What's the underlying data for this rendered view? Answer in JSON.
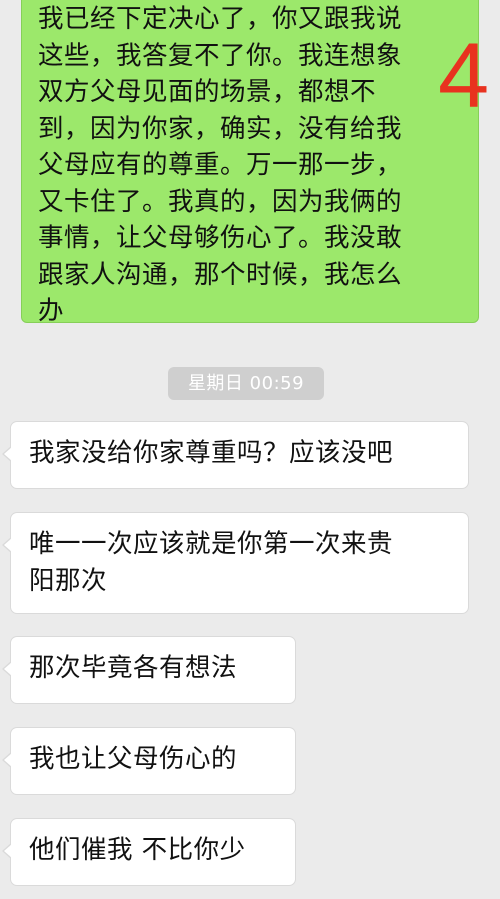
{
  "overlay": {
    "number": "4"
  },
  "messages": {
    "outgoing_1": {
      "text": "我已经下定决心了，你又跟我说\n这些，我答复不了你。我连想象\n双方父母见面的场景，都想不\n到，因为你家，确实，没有给我\n父母应有的尊重。万一那一步，\n又卡住了。我真的，因为我俩的\n事情，让父母够伤心了。我没敢\n跟家人沟通，那个时候，我怎么\n办"
    },
    "timestamp": "星期日 00:59",
    "incoming": [
      {
        "text": "我家没给你家尊重吗？应该没吧"
      },
      {
        "text": "唯一一次应该就是你第一次来贵\n阳那次"
      },
      {
        "text": "那次毕竟各有想法"
      },
      {
        "text": "我也让父母伤心的"
      },
      {
        "text": "他们催我 不比你少"
      }
    ]
  },
  "colors": {
    "background": "#ebebeb",
    "outgoing_bubble": "#9ce86b",
    "incoming_bubble": "#ffffff",
    "timestamp_bg": "#cfcfcf",
    "overlay_number": "#e8321f"
  }
}
